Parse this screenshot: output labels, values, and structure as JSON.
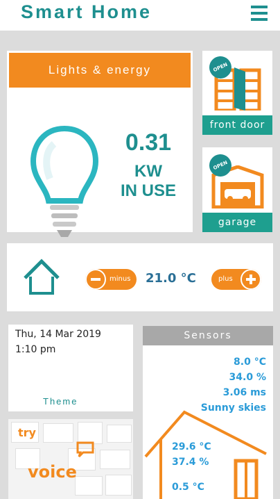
{
  "header": {
    "title": "Smart Home"
  },
  "lights": {
    "title": "Lights & energy",
    "value": "0.31",
    "unit_line1": "KW",
    "unit_line2": "IN USE"
  },
  "front_door": {
    "label": "front door",
    "badge": "OPEN"
  },
  "garage": {
    "label": "garage",
    "badge": "OPEN"
  },
  "thermostat": {
    "minus_label": "minus",
    "plus_label": "plus",
    "temperature": "21.0 °C"
  },
  "datetime": {
    "date": "Thu, 14 Mar 2019",
    "time": "1:10 pm",
    "theme_label": "Theme"
  },
  "voice": {
    "try_label": "try",
    "voice_label": "voice"
  },
  "sensors": {
    "title": "Sensors",
    "outdoor_temp": "8.0 °C",
    "outdoor_humidity": "34.0 %",
    "latency": "3.06 ms",
    "weather": "Sunny skies",
    "indoor_temp": "29.6 °C",
    "indoor_humidity": "37.4 %",
    "indoor_temp2": "0.5 °C"
  },
  "colors": {
    "accent_orange": "#f28a1f",
    "accent_teal": "#1e8f8f",
    "value_blue": "#2a9bd8"
  },
  "icons": [
    "menu-icon",
    "bulb-icon",
    "door-icon",
    "garage-icon",
    "house-icon",
    "minus-icon",
    "plus-icon",
    "speech-bubble-icon"
  ]
}
